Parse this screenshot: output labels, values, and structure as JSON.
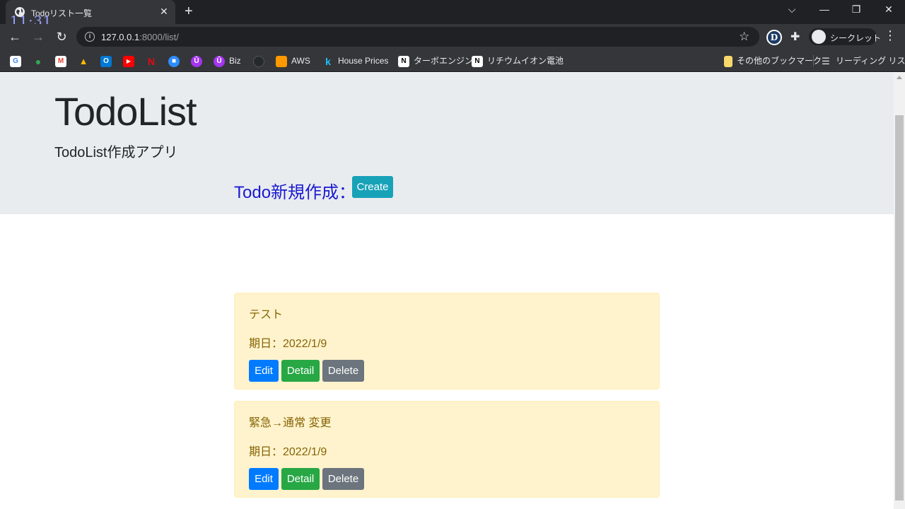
{
  "browser": {
    "tab_title": "Todoリスト一覧",
    "clock": "11:31",
    "url_host": "127.0.0.1",
    "url_path": ":8000/list/",
    "incognito_label": "シークレット",
    "bookmarks": [
      {
        "label": "",
        "icon": "google-icon",
        "color": "#ffffff"
      },
      {
        "label": "",
        "icon": "maps-icon",
        "color": "#34a853"
      },
      {
        "label": "",
        "icon": "gmail-icon",
        "color": "#ea4335"
      },
      {
        "label": "",
        "icon": "drive-icon",
        "color": "#fbbc04"
      },
      {
        "label": "",
        "icon": "outlook-icon",
        "color": "#0078d4"
      },
      {
        "label": "",
        "icon": "youtube-icon",
        "color": "#ff0000"
      },
      {
        "label": "",
        "icon": "netflix-icon",
        "color": "#e50914"
      },
      {
        "label": "",
        "icon": "zoom-icon",
        "color": "#2d8cff"
      },
      {
        "label": "",
        "icon": "udemy-icon",
        "color": "#a435f0"
      },
      {
        "label": "Biz",
        "icon": "udemy-biz-icon",
        "color": "#a435f0"
      },
      {
        "label": "",
        "icon": "github-icon",
        "color": "#24292e"
      },
      {
        "label": "AWS",
        "icon": "aws-icon",
        "color": "#ff9900"
      },
      {
        "label": "House Prices",
        "icon": "kaggle-icon",
        "color": "#20beff"
      },
      {
        "label": "ターボエンジン",
        "icon": "notion-icon",
        "color": "#ffffff"
      },
      {
        "label": "リチウムイオン電池",
        "icon": "notion-icon",
        "color": "#ffffff"
      }
    ],
    "other_bookmarks": "その他のブックマーク",
    "reading_list": "リーディング リスト"
  },
  "jumbotron": {
    "title": "TodoList",
    "subtitle_latin": "TodoList",
    "subtitle_jp": "作成アプリ"
  },
  "create": {
    "heading": "Todo新規作成：",
    "button_label": "Create"
  },
  "todos": [
    {
      "title": "テスト",
      "date": "期日：2022/1/9",
      "edit": "Edit",
      "detail": "Detail",
      "delete": "Delete"
    },
    {
      "title": "緊急→通常 変更",
      "date": "期日：2022/1/9",
      "edit": "Edit",
      "detail": "Detail",
      "delete": "Delete"
    }
  ],
  "colors": {
    "create_heading": "#1a1ad1",
    "card_bg": "#fff3cd",
    "card_text": "#856404",
    "edit_button": "#007bff",
    "detail_button": "#28a745",
    "delete_button": "#6c757d",
    "create_button": "#17a2b8"
  }
}
